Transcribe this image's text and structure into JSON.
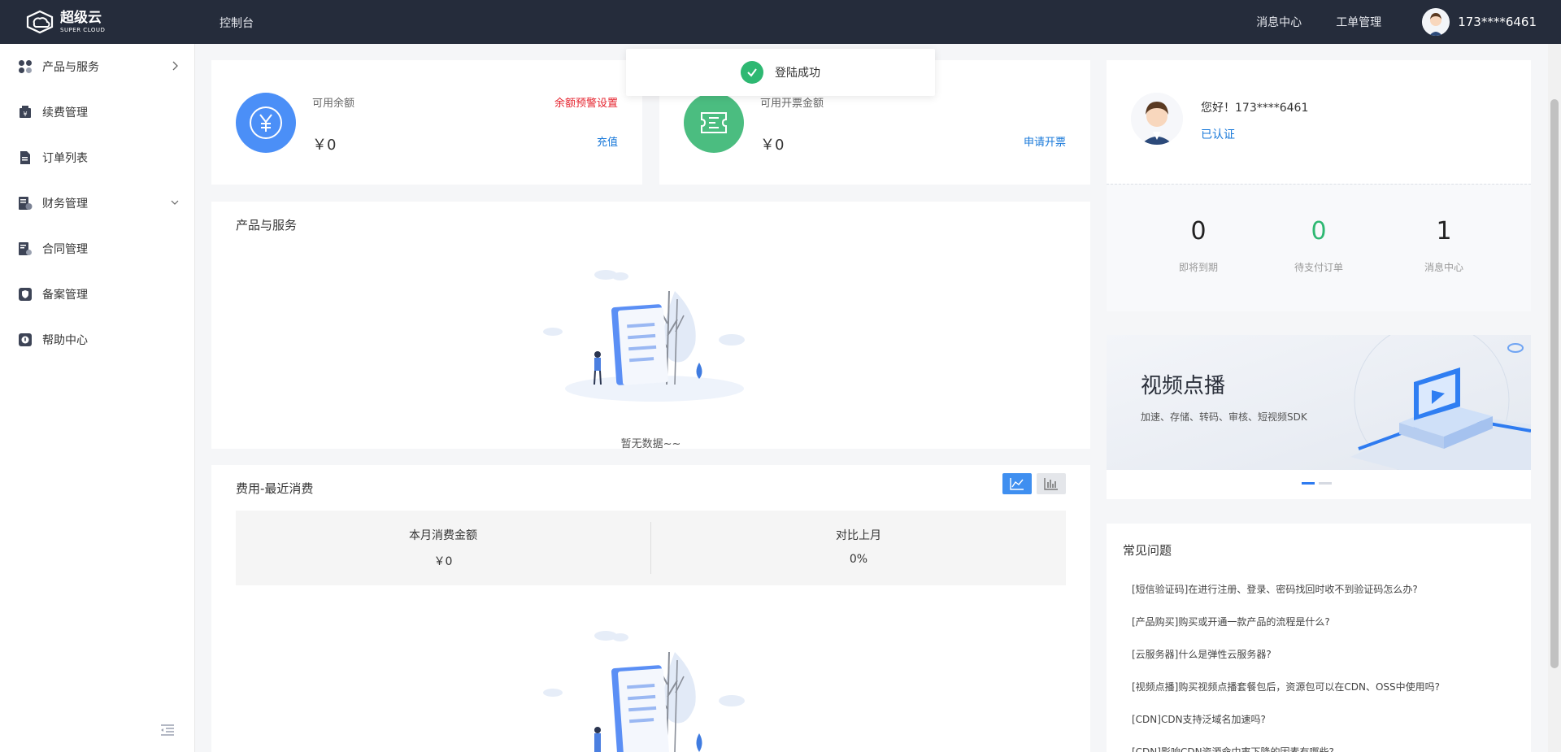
{
  "topbar": {
    "logo_cn": "超级云",
    "logo_en": "SUPER CLOUD",
    "console": "控制台",
    "messages": "消息中心",
    "tickets": "工单管理",
    "user_phone": "173****6461"
  },
  "sidebar": {
    "items": [
      {
        "label": "产品与服务",
        "icon": "grid-icon"
      },
      {
        "label": "续费管理",
        "icon": "renew-icon"
      },
      {
        "label": "订单列表",
        "icon": "document-icon"
      },
      {
        "label": "财务管理",
        "icon": "finance-icon"
      },
      {
        "label": "合同管理",
        "icon": "contract-icon"
      },
      {
        "label": "备案管理",
        "icon": "shield-icon"
      },
      {
        "label": "帮助中心",
        "icon": "help-icon"
      }
    ]
  },
  "toast": {
    "text": "登陆成功"
  },
  "balance": {
    "label": "可用余额",
    "warning_link": "余额预警设置",
    "amount": "￥0",
    "recharge": "充值"
  },
  "invoice": {
    "label": "可用开票金额",
    "amount": "￥0",
    "apply": "申请开票"
  },
  "products": {
    "title": "产品与服务",
    "empty_text": "暂无数据~~"
  },
  "costs": {
    "title": "费用-最近消费",
    "month_label": "本月消费金额",
    "month_value": "￥0",
    "compare_label": "对比上月",
    "compare_value": "0%"
  },
  "profile": {
    "greeting": "您好！173****6461",
    "verified": "已认证"
  },
  "stats": [
    {
      "value": "0",
      "label": "即将到期",
      "color": "#222222"
    },
    {
      "value": "0",
      "label": "待支付订单",
      "color": "#2eb872"
    },
    {
      "value": "1",
      "label": "消息中心",
      "color": "#222222"
    }
  ],
  "banner": {
    "title": "视频点播",
    "subtitle": "加速、存储、转码、审核、短视频SDK"
  },
  "faq": {
    "title": "常见问题",
    "items": [
      "[短信验证码]在进行注册、登录、密码找回时收不到验证码怎么办?",
      "[产品购买]购买或开通一款产品的流程是什么?",
      "[云服务器]什么是弹性云服务器?",
      "[视频点播]购买视频点播套餐包后，资源包可以在CDN、OSS中使用吗?",
      "[CDN]CDN支持泛域名加速吗?",
      "[CDN]影响CDN资源命中率下降的因素有哪些?"
    ]
  },
  "colors": {
    "topbar": "#252c3b",
    "accent_blue": "#1677d9",
    "balance_circle": "#4b8ff7",
    "invoice_circle": "#4bbd80",
    "success_green": "#2eb872",
    "warning_red": "#e5222d"
  }
}
